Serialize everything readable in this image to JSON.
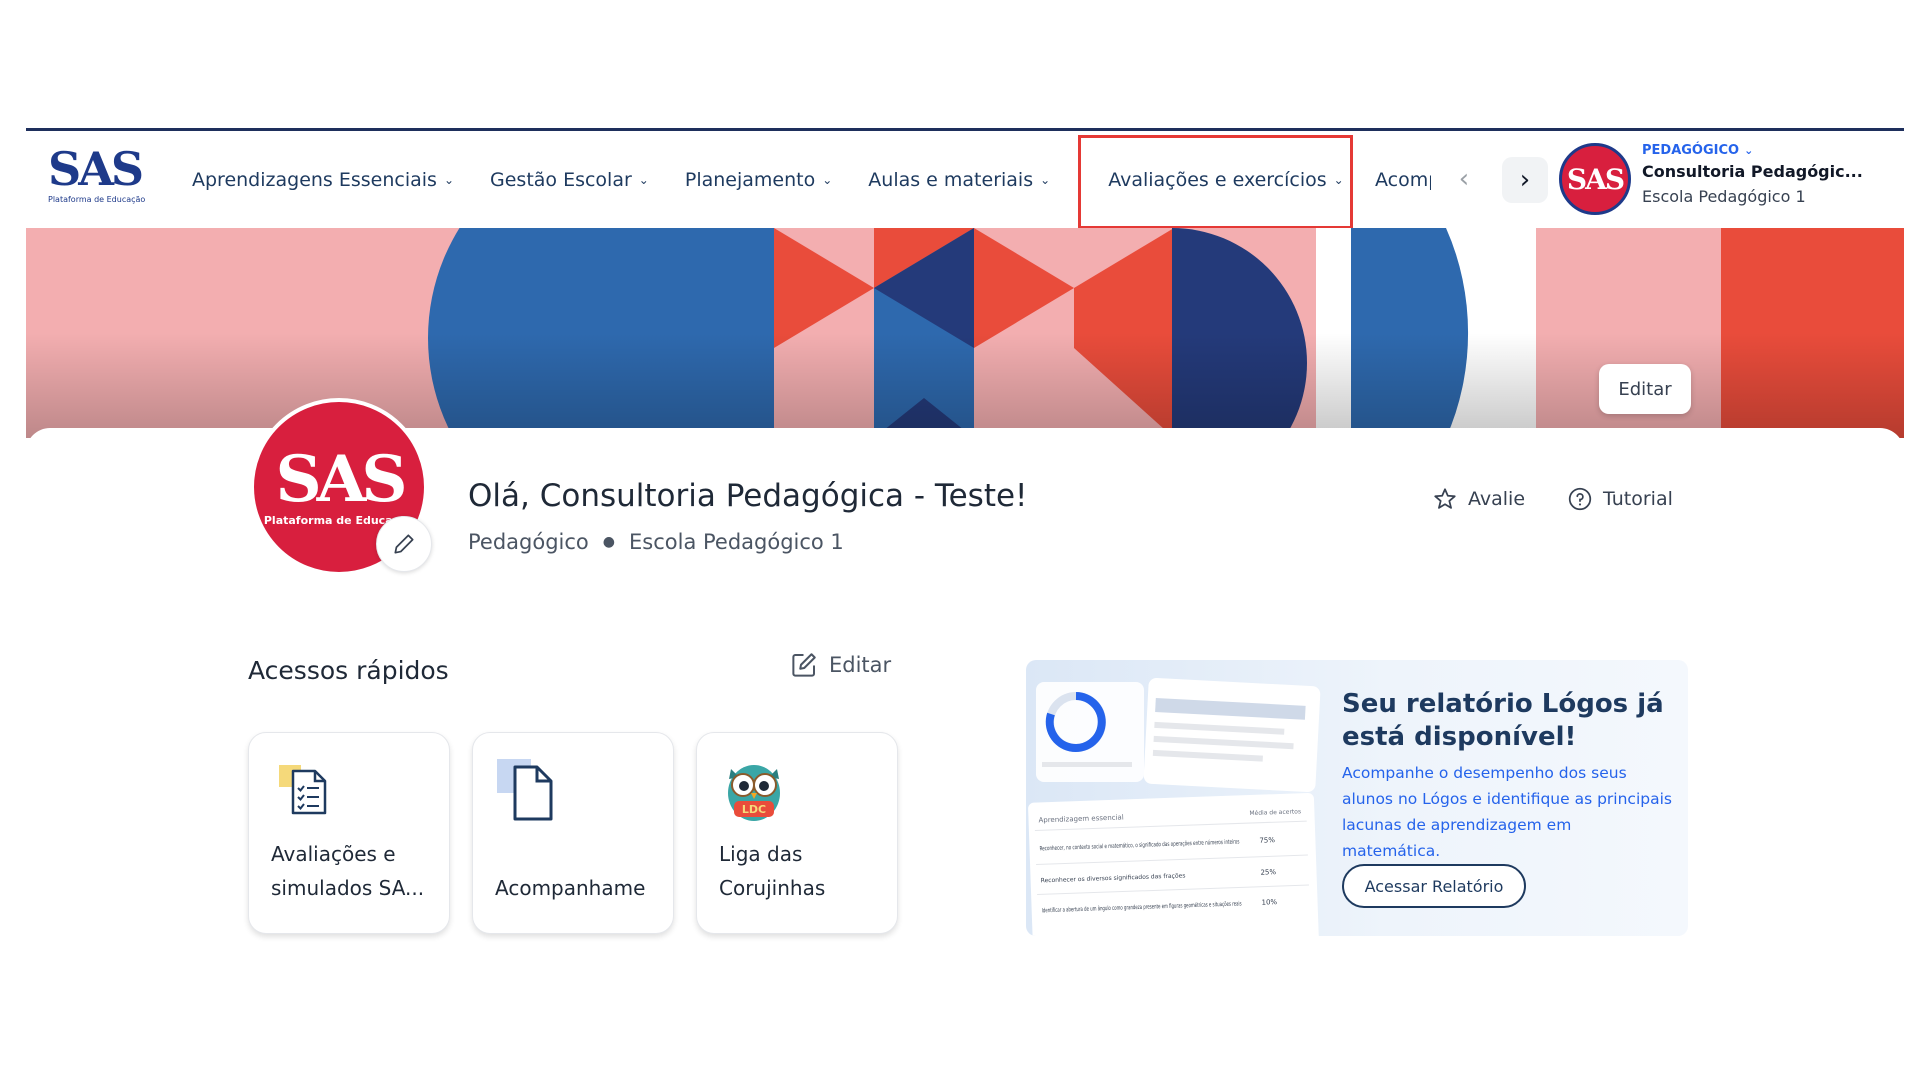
{
  "brand": {
    "logo_text": "SAS",
    "logo_sub": "Plataforma de Educação",
    "primary_color": "#1e3a8a",
    "accent_color": "#d81f3e",
    "highlight_color": "#e53935"
  },
  "nav": {
    "items": [
      {
        "label": "Aprendizagens Essenciais",
        "icon": "chevron-down-icon"
      },
      {
        "label": "Gestão Escolar",
        "icon": "chevron-down-icon"
      },
      {
        "label": "Planejamento",
        "icon": "chevron-down-icon"
      },
      {
        "label": "Aulas e materiais",
        "icon": "chevron-down-icon"
      },
      {
        "label": "Avaliações e exercícios",
        "icon": "chevron-down-icon",
        "highlighted": true
      }
    ],
    "cut_item": "Acompanhamento",
    "prev_icon": "chevron-left-icon",
    "next_icon": "chevron-right-icon"
  },
  "profile": {
    "avatar_text": "SAS",
    "role": "PEDAGÓGICO",
    "name": "Consultoria Pedagógic...",
    "school": "Escola Pedagógico 1"
  },
  "banner": {
    "edit_label": "Editar"
  },
  "main": {
    "avatar_text": "SAS",
    "avatar_sub": "Plataforma de Educação",
    "greeting": "Olá, Consultoria Pedagógica - Teste!",
    "role": "Pedagógico",
    "school": "Escola Pedagógico 1",
    "rate_label": "Avalie",
    "tutorial_label": "Tutorial"
  },
  "quick_access": {
    "title": "Acessos rápidos",
    "edit_label": "Editar",
    "cards": [
      {
        "line1": "Avaliações e",
        "line2": "simulados SA...",
        "icon": "checklist-document-icon"
      },
      {
        "line1": "",
        "line2": "Acompanhame",
        "icon": "file-icon"
      },
      {
        "line1": "Liga das",
        "line2": "Corujinhas",
        "icon": "owl-icon"
      }
    ]
  },
  "promo": {
    "title": "Seu relatório Lógos já está disponível!",
    "text": "Acompanhe o desempenho dos seus alunos no Lógos e identifique as principais lacunas de aprendizagem em matemática.",
    "button": "Acessar Relatório",
    "preview": {
      "header_col1": "Aprendizagem essencial",
      "header_col2": "Média de acertos",
      "rows": [
        {
          "text": "Reconhecer, no contexto social e matemático, o significado das operações entre números inteiros",
          "value": "75%"
        },
        {
          "text": "Reconhecer os diversos significados das frações",
          "value": "25%"
        },
        {
          "text": "Identificar a abertura de um ângulo como grandeza presente em figuras geométricas e situações reais",
          "value": "10%"
        }
      ]
    }
  }
}
